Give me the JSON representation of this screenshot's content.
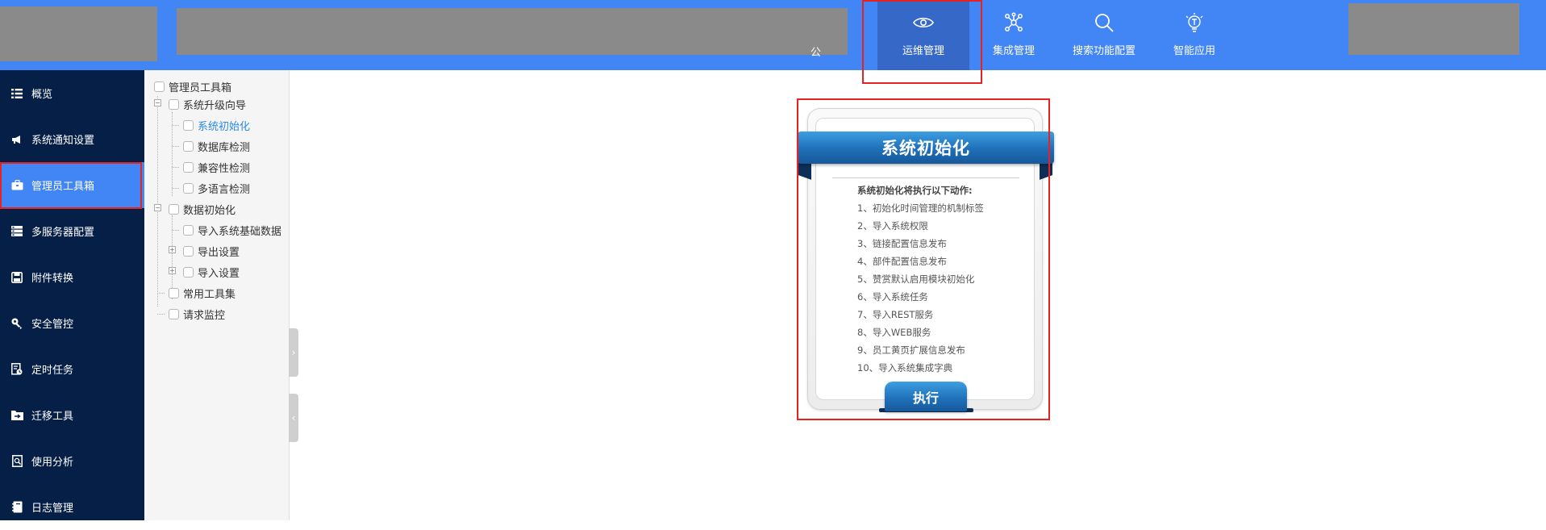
{
  "header": {
    "nav_partial_text": "公",
    "nav": [
      {
        "label": "运维管理",
        "icon": "eye-icon",
        "active": true
      },
      {
        "label": "集成管理",
        "icon": "network-icon",
        "active": false
      },
      {
        "label": "搜索功能配置",
        "icon": "search-icon",
        "active": false
      },
      {
        "label": "智能应用",
        "icon": "lightbulb-icon",
        "active": false
      }
    ]
  },
  "sidebar": {
    "items": [
      {
        "label": "概览",
        "icon": "list-icon"
      },
      {
        "label": "系统通知设置",
        "icon": "megaphone-icon"
      },
      {
        "label": "管理员工具箱",
        "icon": "toolbox-icon",
        "active": true
      },
      {
        "label": "多服务器配置",
        "icon": "server-icon"
      },
      {
        "label": "附件转换",
        "icon": "save-icon"
      },
      {
        "label": "安全管控",
        "icon": "key-icon"
      },
      {
        "label": "定时任务",
        "icon": "scheduled-doc-icon"
      },
      {
        "label": "迁移工具",
        "icon": "folder-arrow-icon"
      },
      {
        "label": "使用分析",
        "icon": "analysis-doc-icon"
      },
      {
        "label": "日志管理",
        "icon": "log-book-icon"
      }
    ]
  },
  "tree": {
    "root": "管理员工具箱",
    "n1": "系统升级向导",
    "n1_1": "系统初始化",
    "n1_2": "数据库检测",
    "n1_3": "兼容性检测",
    "n1_4": "多语言检测",
    "n2": "数据初始化",
    "n2_1": "导入系统基础数据",
    "n2_2": "导出设置",
    "n2_3": "导入设置",
    "n3": "常用工具集",
    "n4": "请求监控",
    "selected": "系统初始化"
  },
  "card": {
    "title": "系统初始化",
    "intro": "系统初始化将执行以下动作:",
    "steps": [
      "1、初始化时间管理的机制标签",
      "2、导入系统权限",
      "3、链接配置信息发布",
      "4、部件配置信息发布",
      "5、赞赏默认启用模块初始化",
      "6、导入系统任务",
      "7、导入REST服务",
      "8、导入WEB服务",
      "9、员工黄页扩展信息发布",
      "10、导入系统集成字典"
    ],
    "execute_label": "执行"
  },
  "colors": {
    "topbar": "#4285f4",
    "nav_active": "#3568c7",
    "sidebar": "#061f47",
    "sidebar_active": "#4285f4",
    "tree_selected": "#2b8be6",
    "ribbon": "#1e6fb8",
    "highlight": "#e62222"
  }
}
